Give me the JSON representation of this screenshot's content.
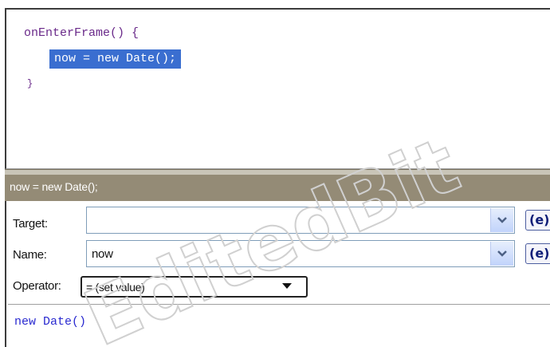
{
  "code_editor": {
    "lines": [
      "onEnterFrame() {",
      "now = new Date();",
      "}"
    ]
  },
  "statement_bar": {
    "text": "now = new Date();"
  },
  "properties": {
    "target": {
      "label": "Target:",
      "value": ""
    },
    "name": {
      "label": "Name:",
      "value": "now"
    },
    "operator": {
      "label": "Operator:",
      "value": "= (set value)"
    },
    "expression_button": "(e)",
    "expression": "new Date()"
  },
  "watermark": "EditedBit",
  "colors": {
    "selection": "#3a6ed0",
    "statement_bar": "#948b76",
    "code_text": "#6a2a8a",
    "expression_text": "#2a2ad0"
  }
}
